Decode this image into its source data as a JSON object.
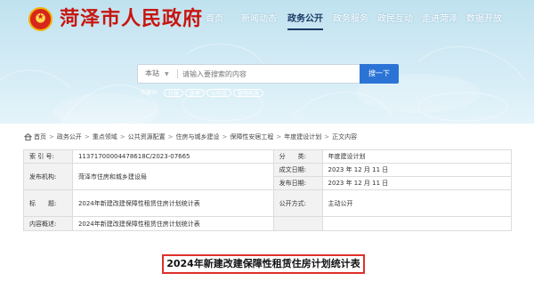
{
  "site": {
    "name": "菏泽市人民政府"
  },
  "nav": [
    {
      "label": "首页",
      "active": false
    },
    {
      "label": "新闻动态",
      "active": false
    },
    {
      "label": "政务公开",
      "active": true
    },
    {
      "label": "政务服务",
      "active": false
    },
    {
      "label": "政民互动",
      "active": false
    },
    {
      "label": "走进菏泽",
      "active": false
    },
    {
      "label": "数据开放",
      "active": false
    }
  ],
  "search": {
    "scope": "本站",
    "placeholder": "请输入要搜索的内容",
    "button": "搜一下",
    "hot_label": "热搜词:",
    "hot_words": [
      "社保",
      "医保",
      "公积金",
      "营商环境"
    ]
  },
  "breadcrumb": [
    "首页",
    "政务公开",
    "重点领域",
    "公共资源配置",
    "住房与城乡建设",
    "保障性安居工程",
    "年度建设计划",
    "正文内容"
  ],
  "info": {
    "index_label": "索 引 号:",
    "index_value": "11371700004478618C/2023-07665",
    "category_label": "分　　类:",
    "category_value": "年度建设计划",
    "publisher_label": "发布机构:",
    "publisher_value": "菏泽市住房和城乡建设局",
    "created_label": "成文日期:",
    "created_value": "2023 年 12 月 11 日",
    "issued_label": "发布日期:",
    "issued_value": "2023 年 12 月 11 日",
    "title_label": "标　　题:",
    "title_value": "2024年新建改建保障性租赁住房计划统计表",
    "mode_label": "公开方式:",
    "mode_value": "主动公开",
    "summary_label": "内容概述:",
    "summary_value": "2024年新建改建保障性租赁住房计划统计表"
  },
  "document_title": "2024年新建改建保障性租赁住房计划统计表",
  "colors": {
    "brand_red": "#c8150f",
    "nav_active": "#1a3a66",
    "search_button": "#2b74d6",
    "title_border": "#e0302a"
  }
}
